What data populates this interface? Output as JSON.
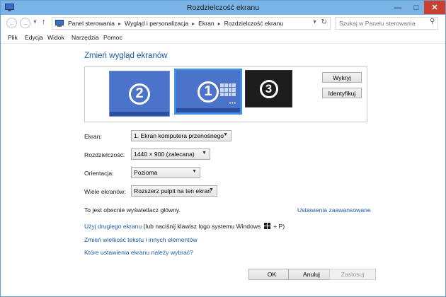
{
  "window": {
    "title": "Rozdzielczość ekranu"
  },
  "address": {
    "crumbs": [
      "Panel sterowania",
      "Wygląd i personalizacja",
      "Ekran",
      "Rozdzielczość ekranu"
    ],
    "search_placeholder": "Szukaj w Panelu sterowania"
  },
  "menu": [
    "Plik",
    "Edycja",
    "Widok",
    "Narzędzia",
    "Pomoc"
  ],
  "main": {
    "heading": "Zmień wygląd ekranów",
    "monitors": [
      "2",
      "1",
      "3"
    ],
    "detect_label": "Wykryj",
    "identify_label": "Identyfikuj",
    "fields": {
      "display_label": "Ekran:",
      "display_value": "1. Ekran komputera przenośnego",
      "resolution_label": "Rozdzielczość:",
      "resolution_value": "1440 × 900 (zalecana)",
      "orientation_label": "Orientacja:",
      "orientation_value": "Pozioma",
      "multiple_label": "Wiele ekranów:",
      "multiple_value": "Rozszerz pulpit na ten ekran"
    },
    "primary_text": "To jest obecnie wyświetlacz główny.",
    "advanced_link": "Ustawienia zaawansowane",
    "second_screen_link": "Użyj drugiego ekranu",
    "second_screen_hint_a": "(lub naciśnij klawisz logo systemu Windows",
    "second_screen_hint_b": "+ P)",
    "text_size_link": "Zmień wielkość tekstu i innych elementów",
    "which_settings_link": "Które ustawienia ekranu należy wybrać?"
  },
  "footer": {
    "ok": "OK",
    "cancel": "Anuluj",
    "apply": "Zastosuj"
  }
}
